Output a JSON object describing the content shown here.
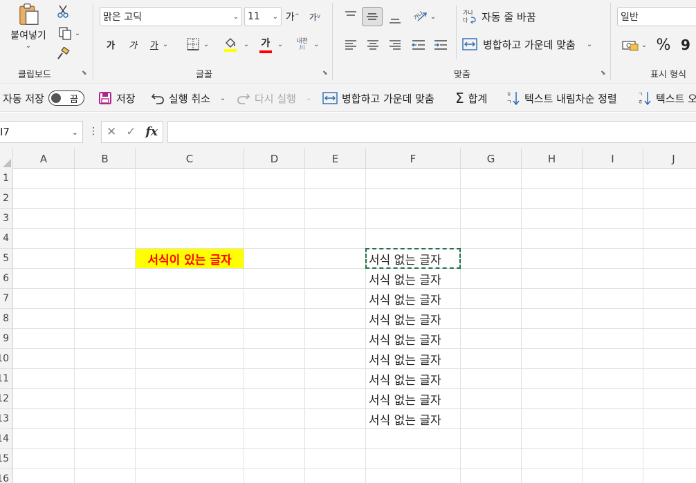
{
  "ribbon": {
    "clipboard": {
      "paste_label": "붙여넣기",
      "group_label": "클립보드"
    },
    "font": {
      "font_name": "맑은 고딕",
      "font_size": "11",
      "grow_label": "가",
      "shrink_label": "가",
      "bold_label": "가",
      "italic_label": "가",
      "underline_label": "가",
      "font_color_label": "가",
      "phonetic_label_top": "내천",
      "group_label": "글꼴",
      "fill_color": "#ffff00",
      "font_color": "#ff0000"
    },
    "alignment": {
      "wrap_text_label": "자동 줄 바꿈",
      "merge_center_label": "병합하고 가운데 맞춤",
      "group_label": "맞춤"
    },
    "number": {
      "format_value": "일반",
      "percent_label": "%",
      "comma_label": "9",
      "group_label": "표시 형식"
    }
  },
  "qat": {
    "autosave_label": "자동 저장",
    "autosave_state": "끔",
    "save_label": "저장",
    "undo_label": "실행 취소",
    "redo_label": "다시 실행",
    "merge_center_label": "병합하고 가운데 맞춤",
    "sum_label": "합계",
    "sort_desc_label": "텍스트 내림차순 정렬",
    "sort_asc_label": "텍스트 오"
  },
  "formula_bar": {
    "name_box": "I7",
    "fx_label": "fx",
    "formula": ""
  },
  "grid": {
    "columns": [
      "A",
      "B",
      "C",
      "D",
      "E",
      "F",
      "G",
      "H",
      "I",
      "J"
    ],
    "rows": [
      "1",
      "2",
      "3",
      "4",
      "5",
      "6",
      "7",
      "8",
      "9",
      "10",
      "11",
      "12",
      "13",
      "14",
      "15",
      "16"
    ],
    "formatted_cell": {
      "ref": "C5",
      "text": "서식이 있는 글자"
    },
    "plain_cells": [
      {
        "ref": "F5",
        "text": "서식 없는 글자"
      },
      {
        "ref": "F6",
        "text": "서식 없는 글자"
      },
      {
        "ref": "F7",
        "text": "서식 없는 글자"
      },
      {
        "ref": "F8",
        "text": "서식 없는 글자"
      },
      {
        "ref": "F9",
        "text": "서식 없는 글자"
      },
      {
        "ref": "F10",
        "text": "서식 없는 글자"
      },
      {
        "ref": "F11",
        "text": "서식 없는 글자"
      },
      {
        "ref": "F12",
        "text": "서식 없는 글자"
      },
      {
        "ref": "F13",
        "text": "서식 없는 글자"
      }
    ],
    "copy_marquee_color": "#217346"
  }
}
